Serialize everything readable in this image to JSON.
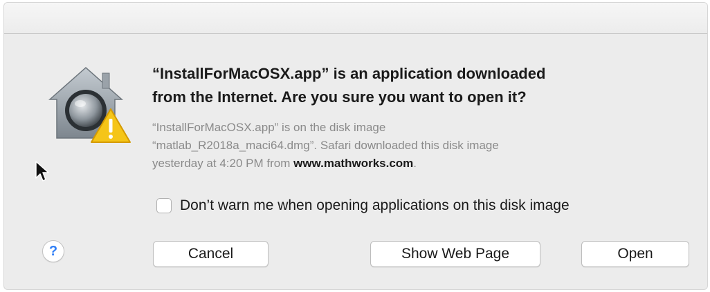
{
  "dialog": {
    "heading_line1": "“InstallForMacOSX.app” is an application downloaded",
    "heading_line2": "from the Internet. Are you sure you want to open it?",
    "body_line1": "“InstallForMacOSX.app” is on the disk image",
    "body_line2": "“matlab_R2018a_maci64.dmg”. Safari downloaded this disk image",
    "body_line3_prefix": "yesterday at 4:20 PM from ",
    "body_line3_link": "www.mathworks.com",
    "body_line3_suffix": ".",
    "checkbox_label": "Don’t warn me when opening applications on this disk image",
    "checkbox_checked": false,
    "icon": "gatekeeper-warning-icon",
    "warning_color": "#f5c518",
    "help_label": "?",
    "buttons": {
      "cancel": "Cancel",
      "show_web_page": "Show Web Page",
      "open": "Open"
    }
  }
}
